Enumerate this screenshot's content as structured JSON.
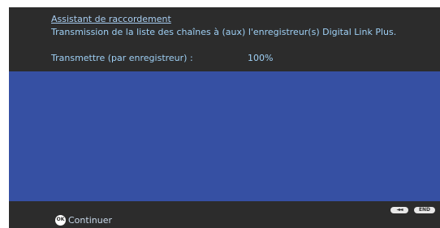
{
  "header": {
    "breadcrumb": "Assistant de raccordement",
    "subtitle": "Transmission de la liste des chaînes à (aux) l'enregistreur(s) Digital Link Plus.",
    "progress_label": "Transmettre (par enregistreur) :",
    "progress_value": "100%",
    "progress_percent": 100
  },
  "footer": {
    "ok_icon_text": "OK",
    "continue_label": "Continuer",
    "rewind_icon_text": "◄◄",
    "end_label": "END"
  },
  "colors": {
    "background": "#2c2c2c",
    "content_panel": "#3650a3",
    "text": "#9fd0f5",
    "link": "#a8cdf0"
  },
  "icons": {
    "ok": "ok-circle-icon",
    "rewind": "rewind-icon"
  }
}
